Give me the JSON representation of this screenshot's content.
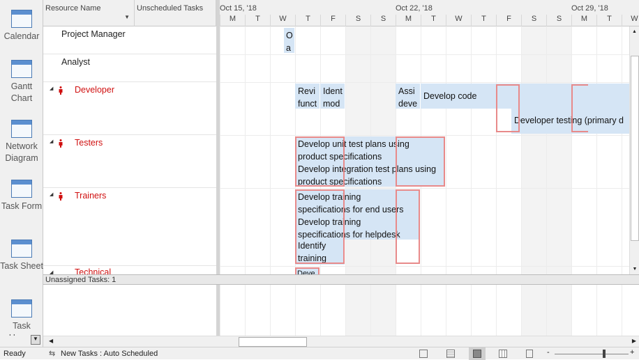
{
  "sidebar": {
    "items": [
      {
        "label": "Calendar",
        "icon": "calendar-icon"
      },
      {
        "label": "Gantt Chart",
        "icon": "gantt-chart-icon"
      },
      {
        "label": "Network Diagram",
        "icon": "network-diagram-icon"
      },
      {
        "label": "Task Form",
        "icon": "task-form-icon"
      },
      {
        "label": "Task Sheet",
        "icon": "task-sheet-icon"
      },
      {
        "label": "Task Usage",
        "icon": "task-usage-icon"
      }
    ]
  },
  "grid": {
    "columns": [
      "Resource Name",
      "Unscheduled Tasks"
    ]
  },
  "timescale": {
    "weeks": [
      "Oct 15, '18",
      "Oct 22, '18",
      "Oct 29, '18"
    ],
    "days": [
      "M",
      "T",
      "W",
      "T",
      "F",
      "S",
      "S",
      "M",
      "T",
      "W",
      "T",
      "F",
      "S",
      "S",
      "M",
      "T",
      "W"
    ]
  },
  "resources": [
    {
      "name": "Project Manager",
      "overallocated": false
    },
    {
      "name": "Analyst",
      "overallocated": false
    },
    {
      "name": "Developer",
      "overallocated": true
    },
    {
      "name": "Testers",
      "overallocated": true
    },
    {
      "name": "Trainers",
      "overallocated": true
    },
    {
      "name": "Technical",
      "overallocated": true
    }
  ],
  "tasks": {
    "pm": [
      "O",
      "a"
    ],
    "dev": {
      "t1": [
        "Revi",
        "funct"
      ],
      "t2": [
        "Ident",
        "mod"
      ],
      "t3": [
        "Assi",
        "deve"
      ],
      "t4": "Develop code",
      "t5": "Developer testing (primary d"
    },
    "testers": [
      "Develop unit test plans using",
      "product specifications",
      "Develop integration test plans using",
      "product specifications"
    ],
    "trainers": [
      "Develop training",
      "specifications for end users",
      "Develop training",
      "specifications for helpdesk",
      "Identify",
      "training"
    ],
    "technical": "Deve"
  },
  "unassigned": "Unassigned Tasks: 1",
  "status": {
    "ready": "Ready",
    "new_tasks": "New Tasks : Auto Scheduled"
  },
  "colors": {
    "task_bar": "#d5e5f5",
    "overallocation": "#e88a8a",
    "overallocated_resource": "#d01010"
  }
}
